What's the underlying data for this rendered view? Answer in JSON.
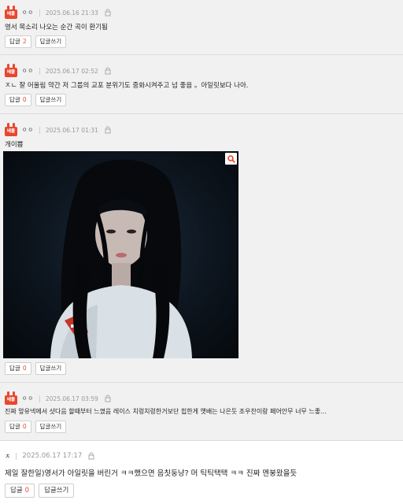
{
  "comments": [
    {
      "best_badge": "베플",
      "nickname": "ㅇㅇ",
      "date": "2025.06.16 21:33",
      "text": "영서 목소리 나오는 순간 곡이 환기됨",
      "reply_label": "답글",
      "reply_count": "2",
      "write_reply_label": "답글쓰기"
    },
    {
      "best_badge": "베플",
      "nickname": "ㅇㅇ",
      "date": "2025.06.17 02:52",
      "text": "ㅈㄴ 잘 어울림 약간 저 그룹의 교포 분위기도 중화시켜주고 넘 좋음 。아일릿보다 나아.",
      "reply_label": "답글",
      "reply_count": "0",
      "write_reply_label": "답글쓰기"
    },
    {
      "best_badge": "베플",
      "nickname": "ㅇㅇ",
      "date": "2025.06.17 01:31",
      "text": "개이쁨",
      "reply_label": "답글",
      "reply_count": "0",
      "write_reply_label": "답글쓰기"
    },
    {
      "best_badge": "베플",
      "nickname": "ㅇㅇ",
      "date": "2025.06.17 03:59",
      "text": "진짜 앞유넥에서 샷다음 할때부터 느꼈음 레이스 치렁치렁한거보단 힙한게 옛배는 나은듯 조우찬이랑 페어안무 너무 느좋...",
      "reply_label": "답글",
      "reply_count": "0",
      "write_reply_label": "답글쓰기"
    },
    {
      "nickname": "ㅈ",
      "date": "2025.06.17 17:17",
      "text": "제일 잘한일)영서가 아일릿을 버린거 ㅋㅋ했으면 음칫둥냥? 머 틱틱택택 ㅋㅋ 진짜 멘붕왔을듯",
      "reply_label": "답글",
      "reply_count": "0",
      "write_reply_label": "답글쓰기"
    }
  ],
  "icons": {
    "lock": "lock-icon",
    "zoom": "magnifier-icon",
    "badge": "best-comment-badge"
  },
  "colors": {
    "accent": "#e8472f",
    "row_background": "#f1f1f1",
    "divider": "#dcdcdc",
    "date_text": "#999999"
  }
}
